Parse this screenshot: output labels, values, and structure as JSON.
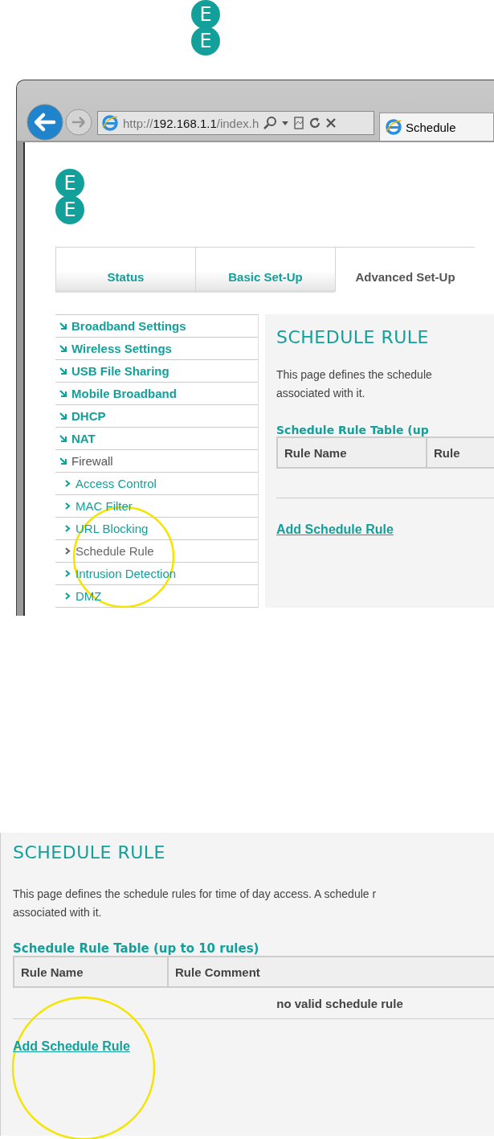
{
  "top_logo": {
    "letters": [
      "E",
      "E"
    ]
  },
  "browser": {
    "address": {
      "scheme": "http://",
      "host": "192.168.1.1",
      "path": "/index.h"
    },
    "tab_title": "Schedule"
  },
  "page": {
    "logo": {
      "letters": [
        "E",
        "E"
      ]
    },
    "tabs": [
      {
        "label": "Status",
        "selected": false
      },
      {
        "label": "Basic Set-Up",
        "selected": false
      },
      {
        "label": "Advanced Set-Up",
        "selected": true
      }
    ],
    "sidebar": {
      "items": [
        {
          "label": "Broadband Settings",
          "expanded": false
        },
        {
          "label": "Wireless Settings",
          "expanded": false
        },
        {
          "label": "USB File Sharing",
          "expanded": false
        },
        {
          "label": "Mobile Broadband",
          "expanded": false
        },
        {
          "label": "DHCP",
          "expanded": false
        },
        {
          "label": "NAT",
          "expanded": false
        },
        {
          "label": "Firewall",
          "expanded": true,
          "children": [
            {
              "label": "Access Control",
              "selected": false
            },
            {
              "label": "MAC Filter",
              "selected": false
            },
            {
              "label": "URL Blocking",
              "selected": false
            },
            {
              "label": "Schedule Rule",
              "selected": true
            },
            {
              "label": "Intrusion Detection",
              "selected": false
            },
            {
              "label": "DMZ",
              "selected": false
            }
          ]
        }
      ]
    },
    "content": {
      "title": "SCHEDULE RULE",
      "description": [
        "This page defines the schedule",
        "associated with it."
      ],
      "table_title": "Schedule Rule Table (up",
      "columns": [
        "Rule Name",
        "Rule"
      ],
      "link": "Add Schedule Rule"
    }
  },
  "detail": {
    "title": "SCHEDULE RULE",
    "description": [
      "This page defines the schedule rules for time of day access. A schedule r",
      "associated with it."
    ],
    "table_title": "Schedule Rule Table (up to 10 rules)",
    "columns": [
      "Rule Name",
      "Rule Comment"
    ],
    "empty_message": "no valid schedule rule",
    "link": "Add Schedule Rule"
  }
}
